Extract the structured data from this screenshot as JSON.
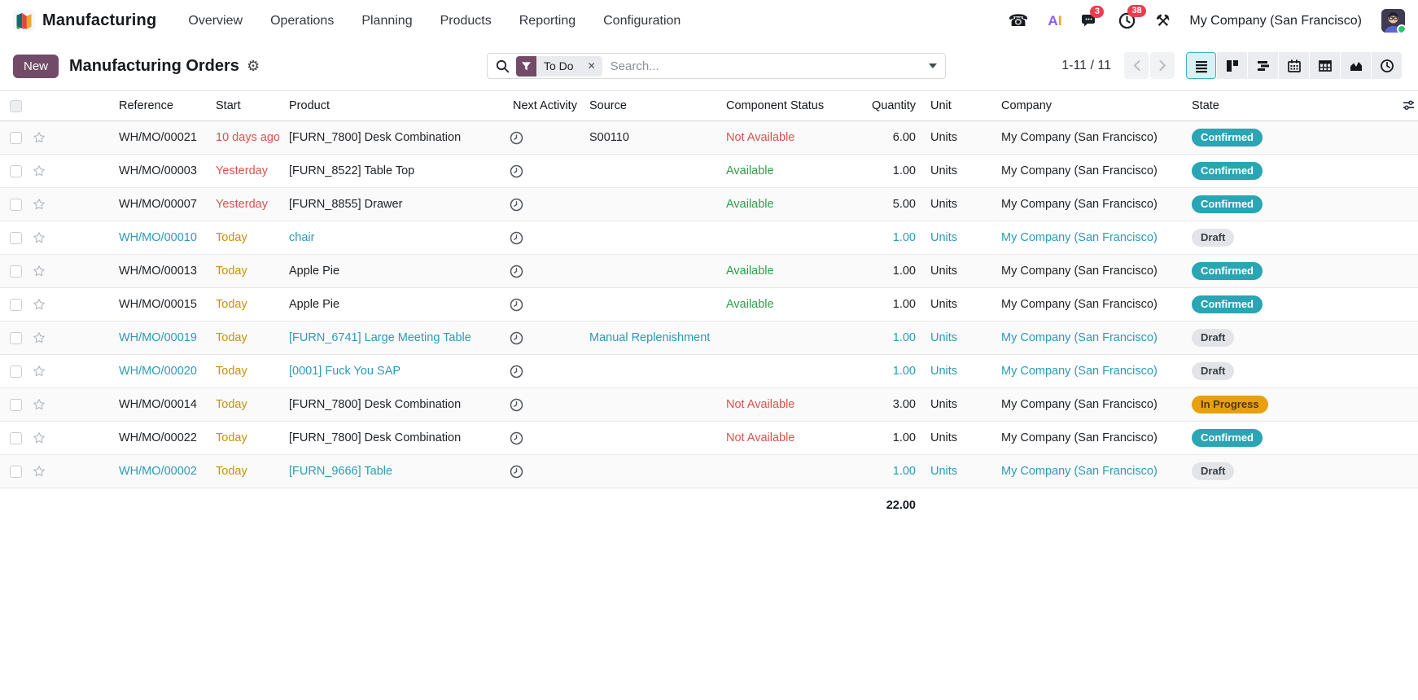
{
  "colors": {
    "accent": "#714B67",
    "info_badge": "#29A5B4",
    "info_text": "#2C9AB7",
    "success": "#2E9E49",
    "danger": "#D9534F",
    "warning_text": "#C7920B",
    "warning_badge": "#E7A10C",
    "notification_red": "#ED3C4E"
  },
  "topbar": {
    "app_name": "Manufacturing",
    "menus": [
      {
        "label": "Overview"
      },
      {
        "label": "Operations"
      },
      {
        "label": "Planning"
      },
      {
        "label": "Products"
      },
      {
        "label": "Reporting"
      },
      {
        "label": "Configuration"
      }
    ],
    "systray": {
      "messages_count": "3",
      "activities_count": "38",
      "company": "My Company (San Francisco)"
    }
  },
  "control_panel": {
    "new_button": "New",
    "title": "Manufacturing Orders",
    "search": {
      "facet_label": "To Do",
      "placeholder": "Search..."
    },
    "pager": {
      "text": "1-11 / 11"
    },
    "views": [
      "list",
      "kanban",
      "gantt",
      "calendar",
      "pivot",
      "graph",
      "activity"
    ],
    "active_view": "list"
  },
  "table": {
    "columns": [
      "Reference",
      "Start",
      "Product",
      "Next Activity",
      "Source",
      "Component Status",
      "Quantity",
      "Unit",
      "Company",
      "State"
    ],
    "rows": [
      {
        "reference": "WH/MO/00021",
        "start": "10 days ago",
        "start_variant": "danger",
        "product": "[FURN_7800] Desk Combination",
        "source": "S00110",
        "component_status": "Not Available",
        "component_variant": "danger",
        "quantity": "6.00",
        "unit": "Units",
        "company": "My Company (San Francisco)",
        "state": "Confirmed",
        "state_variant": "info",
        "row_variant": "normal"
      },
      {
        "reference": "WH/MO/00003",
        "start": "Yesterday",
        "start_variant": "danger",
        "product": "[FURN_8522] Table Top",
        "source": "",
        "component_status": "Available",
        "component_variant": "success",
        "quantity": "1.00",
        "unit": "Units",
        "company": "My Company (San Francisco)",
        "state": "Confirmed",
        "state_variant": "info",
        "row_variant": "normal"
      },
      {
        "reference": "WH/MO/00007",
        "start": "Yesterday",
        "start_variant": "danger",
        "product": "[FURN_8855] Drawer",
        "source": "",
        "component_status": "Available",
        "component_variant": "success",
        "quantity": "5.00",
        "unit": "Units",
        "company": "My Company (San Francisco)",
        "state": "Confirmed",
        "state_variant": "info",
        "row_variant": "normal"
      },
      {
        "reference": "WH/MO/00010",
        "start": "Today",
        "start_variant": "warning",
        "product": "chair",
        "source": "",
        "component_status": "",
        "component_variant": "",
        "quantity": "1.00",
        "unit": "Units",
        "company": "My Company (San Francisco)",
        "state": "Draft",
        "state_variant": "secondary",
        "row_variant": "draft"
      },
      {
        "reference": "WH/MO/00013",
        "start": "Today",
        "start_variant": "warning",
        "product": "Apple Pie",
        "source": "",
        "component_status": "Available",
        "component_variant": "success",
        "quantity": "1.00",
        "unit": "Units",
        "company": "My Company (San Francisco)",
        "state": "Confirmed",
        "state_variant": "info",
        "row_variant": "normal"
      },
      {
        "reference": "WH/MO/00015",
        "start": "Today",
        "start_variant": "warning",
        "product": "Apple Pie",
        "source": "",
        "component_status": "Available",
        "component_variant": "success",
        "quantity": "1.00",
        "unit": "Units",
        "company": "My Company (San Francisco)",
        "state": "Confirmed",
        "state_variant": "info",
        "row_variant": "normal"
      },
      {
        "reference": "WH/MO/00019",
        "start": "Today",
        "start_variant": "warning",
        "product": "[FURN_6741] Large Meeting Table",
        "source": "Manual Replenishment",
        "component_status": "",
        "component_variant": "",
        "quantity": "1.00",
        "unit": "Units",
        "company": "My Company (San Francisco)",
        "state": "Draft",
        "state_variant": "secondary",
        "row_variant": "draft"
      },
      {
        "reference": "WH/MO/00020",
        "start": "Today",
        "start_variant": "warning",
        "product": "[0001] Fuck You SAP",
        "source": "",
        "component_status": "",
        "component_variant": "",
        "quantity": "1.00",
        "unit": "Units",
        "company": "My Company (San Francisco)",
        "state": "Draft",
        "state_variant": "secondary",
        "row_variant": "draft"
      },
      {
        "reference": "WH/MO/00014",
        "start": "Today",
        "start_variant": "warning",
        "product": "[FURN_7800] Desk Combination",
        "source": "",
        "component_status": "Not Available",
        "component_variant": "danger",
        "quantity": "3.00",
        "unit": "Units",
        "company": "My Company (San Francisco)",
        "state": "In Progress",
        "state_variant": "warning",
        "row_variant": "normal"
      },
      {
        "reference": "WH/MO/00022",
        "start": "Today",
        "start_variant": "warning",
        "product": "[FURN_7800] Desk Combination",
        "source": "",
        "component_status": "Not Available",
        "component_variant": "danger",
        "quantity": "1.00",
        "unit": "Units",
        "company": "My Company (San Francisco)",
        "state": "Confirmed",
        "state_variant": "info",
        "row_variant": "normal"
      },
      {
        "reference": "WH/MO/00002",
        "start": "Today",
        "start_variant": "warning",
        "product": "[FURN_9666] Table",
        "source": "",
        "component_status": "",
        "component_variant": "",
        "quantity": "1.00",
        "unit": "Units",
        "company": "My Company (San Francisco)",
        "state": "Draft",
        "state_variant": "secondary",
        "row_variant": "draft"
      }
    ],
    "footer": {
      "total_quantity": "22.00"
    }
  }
}
